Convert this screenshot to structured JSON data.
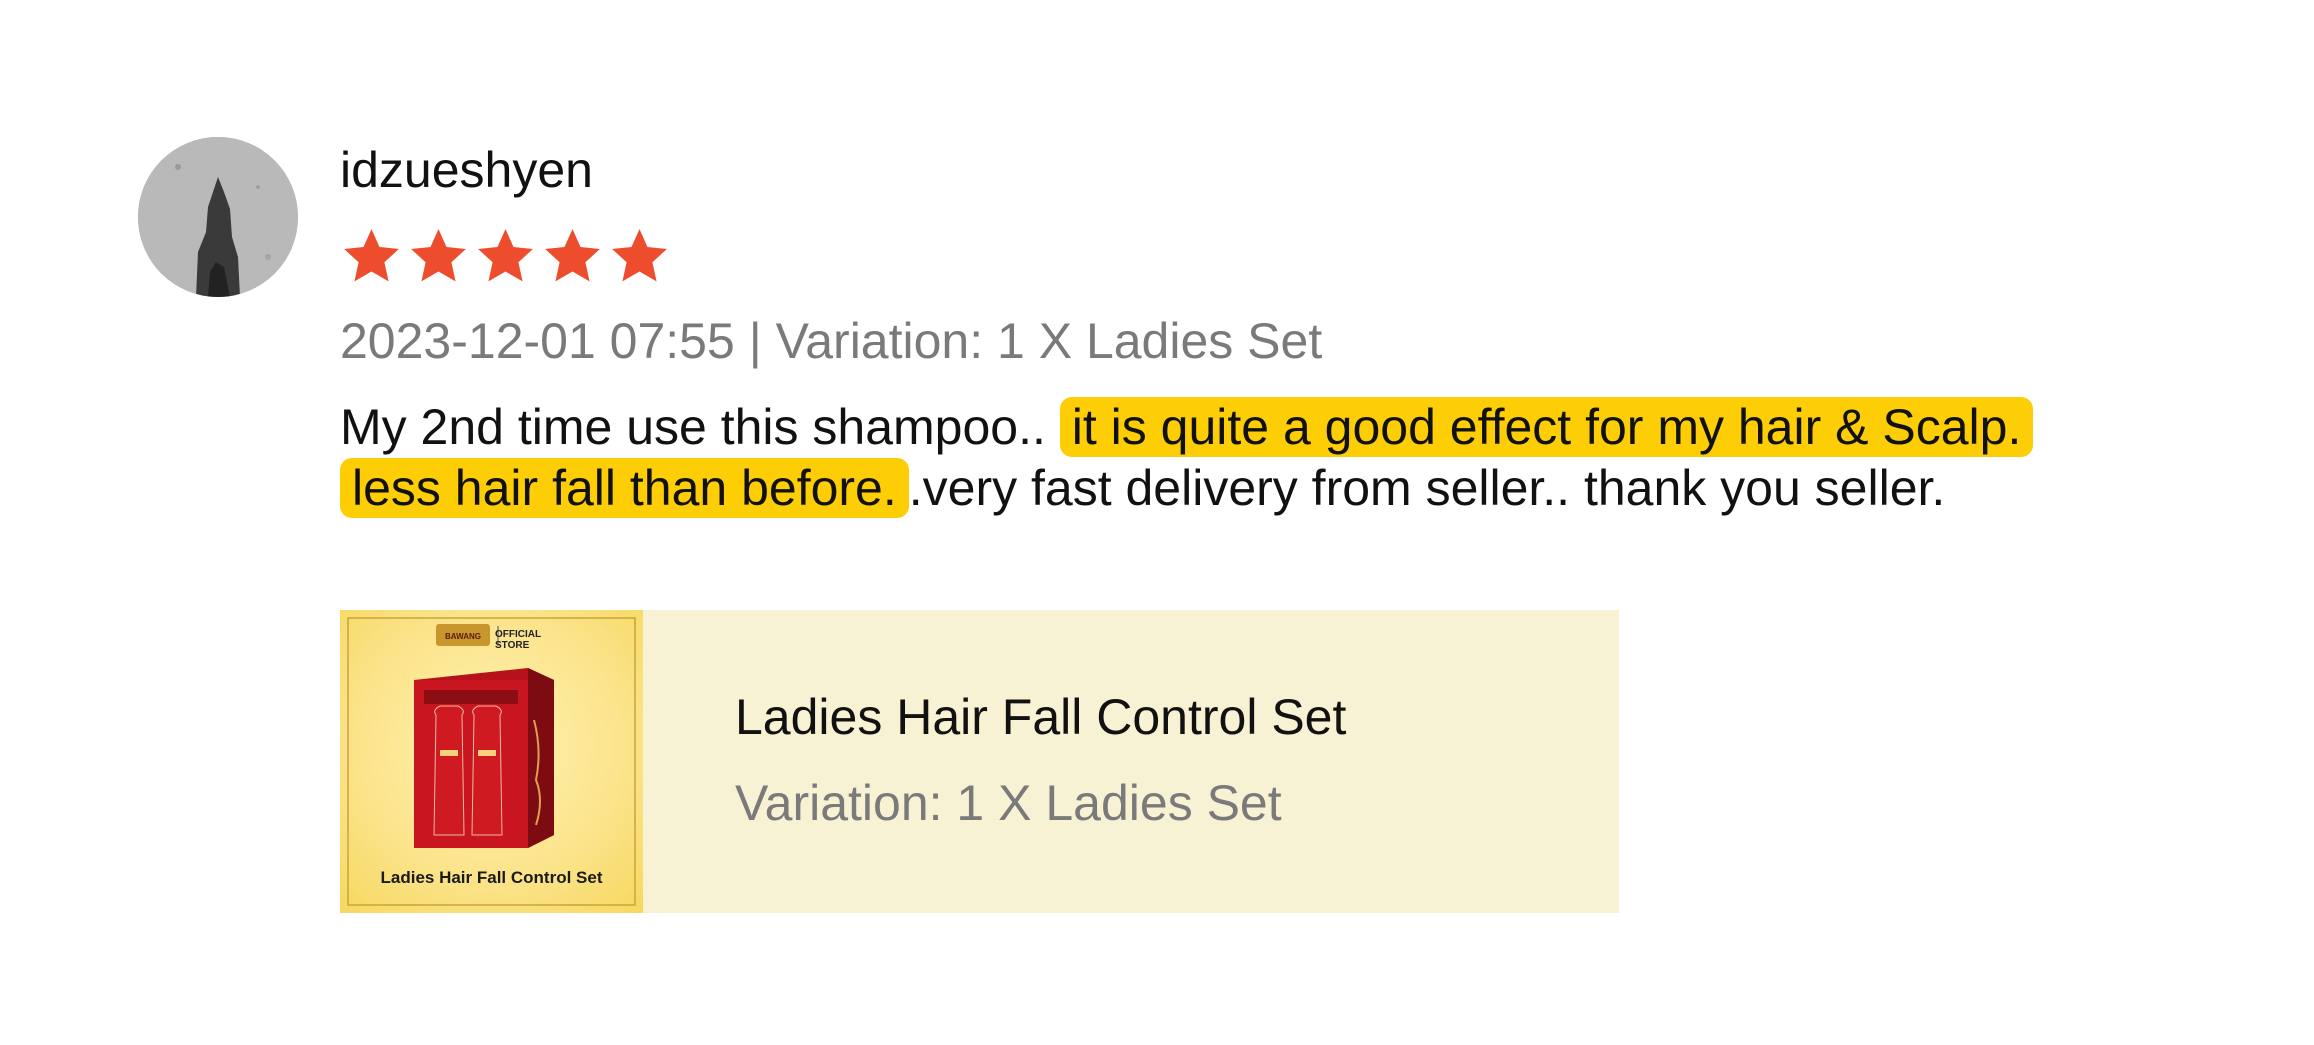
{
  "review": {
    "username": "idzueshyen",
    "rating": 5,
    "rating_max": 5,
    "star_color": "#ee4d2d",
    "date": "2023-12-01 07:55",
    "separator": "|",
    "variation": "Variation: 1 X Ladies Set",
    "comment": {
      "part1": "My 2nd time use this shampoo.. ",
      "highlight": "it is quite a good effect for my hair & Scalp. less hair fall than before.",
      "part2": ".very fast delivery from seller.. thank you seller.",
      "highlight_color": "#fdcd05"
    }
  },
  "product": {
    "name": "Ladies Hair Fall Control Set",
    "variation": "Variation: 1 X Ladies Set",
    "card_color": "#f8f2d5",
    "thumbnail": {
      "caption": "Ladies Hair Fall Control Set",
      "store_label": "OFFICIAL STORE",
      "brand": "BAWANG"
    }
  },
  "icons": {
    "avatar": "user-avatar-photo",
    "star": "star-icon"
  }
}
